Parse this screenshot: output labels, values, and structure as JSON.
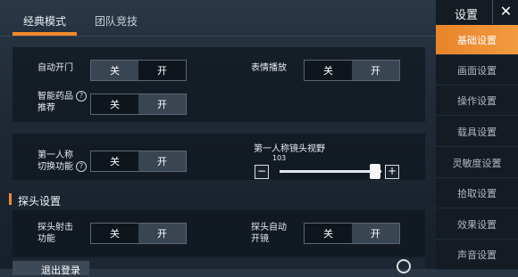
{
  "tabs": {
    "active": "经典模式",
    "other": "团队竞技"
  },
  "settings": {
    "auto_door": {
      "label": "自动开门",
      "off": "关",
      "on": "开"
    },
    "emote": {
      "label": "表情播放",
      "off": "关",
      "on": "开"
    },
    "smart_meds": {
      "label_line1": "智能药品",
      "label_line2": "推荐",
      "off": "关",
      "on": "开"
    },
    "fpp_switch": {
      "label_line1": "第一人称",
      "label_line2": "切换功能",
      "off": "关",
      "on": "开"
    },
    "fpp_fov": {
      "title": "第一人称镜头视野",
      "value": "103",
      "minus": "−",
      "plus": "+"
    }
  },
  "section": {
    "peek_title": "探头设置"
  },
  "peek": {
    "peek_fire": {
      "label_line1": "探头射击",
      "label_line2": "功能",
      "off": "关",
      "on": "开"
    },
    "peek_scope": {
      "label_line1": "探头自动",
      "label_line2": "开镜",
      "off": "关",
      "on": "开"
    }
  },
  "sidebar": {
    "title": "设置",
    "close": "✕",
    "items": [
      {
        "label": "基础设置"
      },
      {
        "label": "画面设置"
      },
      {
        "label": "操作设置"
      },
      {
        "label": "载具设置"
      },
      {
        "label": "灵敏度设置"
      },
      {
        "label": "拾取设置"
      },
      {
        "label": "效果设置"
      },
      {
        "label": "声音设置"
      }
    ]
  },
  "bottom": {
    "logout": "退出登录"
  },
  "colors": {
    "accent": "#f08a2b",
    "sidebar_bg": "#141b23"
  }
}
